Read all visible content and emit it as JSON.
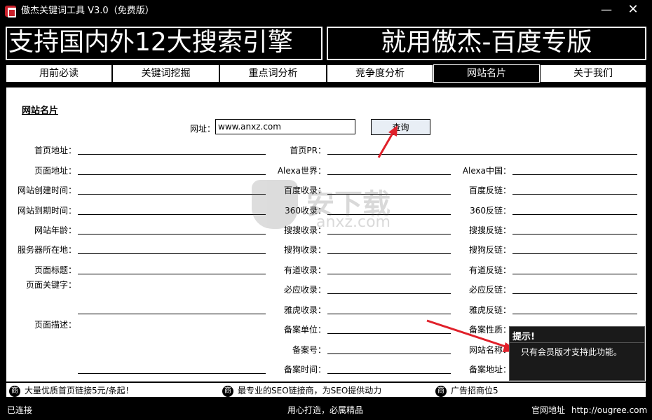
{
  "window": {
    "title": "傲杰关键词工具 V3.0（免费版）",
    "minimize": "—",
    "close": "✕"
  },
  "banner": {
    "left": "支持国内外12大搜索引擎",
    "right": "就用傲杰-百度专版"
  },
  "tabs": [
    {
      "label": "用前必读",
      "active": false
    },
    {
      "label": "关键词挖掘",
      "active": false
    },
    {
      "label": "重点词分析",
      "active": false
    },
    {
      "label": "竞争度分析",
      "active": false
    },
    {
      "label": "网站名片",
      "active": true
    },
    {
      "label": "关于我们",
      "active": false
    }
  ],
  "panel": {
    "section_title": "网站名片",
    "url_label": "网址：",
    "url_value": "www.anxz.com",
    "query_button": "查询"
  },
  "fields": {
    "col1": [
      {
        "label": "首页地址：",
        "value": ""
      },
      {
        "label": "页面地址：",
        "value": ""
      },
      {
        "label": "网站创建时间：",
        "value": ""
      },
      {
        "label": "网站到期时间：",
        "value": ""
      },
      {
        "label": "网站年龄：",
        "value": ""
      },
      {
        "label": "服务器所在地：",
        "value": ""
      },
      {
        "label": "页面标题：",
        "value": ""
      },
      {
        "label": "页面关键字：",
        "value": ""
      },
      {
        "label": "页面描述：",
        "value": ""
      }
    ],
    "homepage_pr": {
      "label": "首页PR：",
      "value": ""
    },
    "col2": [
      {
        "label": "Alexa世界：",
        "value": ""
      },
      {
        "label": "百度收录：",
        "value": ""
      },
      {
        "label": "360收录：",
        "value": ""
      },
      {
        "label": "搜搜收录：",
        "value": ""
      },
      {
        "label": "搜狗收录：",
        "value": ""
      },
      {
        "label": "有道收录：",
        "value": ""
      },
      {
        "label": "必应收录：",
        "value": ""
      },
      {
        "label": "雅虎收录：",
        "value": ""
      },
      {
        "label": "备案单位：",
        "value": ""
      },
      {
        "label": "备案号：",
        "value": ""
      },
      {
        "label": "备案时间：",
        "value": ""
      }
    ],
    "col3": [
      {
        "label": "Alexa中国：",
        "value": ""
      },
      {
        "label": "百度反链：",
        "value": ""
      },
      {
        "label": "360反链：",
        "value": ""
      },
      {
        "label": "搜搜反链：",
        "value": ""
      },
      {
        "label": "搜狗反链：",
        "value": ""
      },
      {
        "label": "有道反链：",
        "value": ""
      },
      {
        "label": "必应反链：",
        "value": ""
      },
      {
        "label": "雅虎反链：",
        "value": ""
      },
      {
        "label": "备案性质：",
        "value": ""
      },
      {
        "label": "网站名称：",
        "value": ""
      },
      {
        "label": "备案地址：",
        "value": ""
      }
    ]
  },
  "watermark": {
    "text": "安下载",
    "sub": "anxz.com"
  },
  "tooltip": {
    "title": "提示!",
    "message": "只有会员版才支持此功能。"
  },
  "ads": [
    {
      "icon": "商",
      "text": "大量优质首页链接5元/条起！"
    },
    {
      "icon": "商",
      "text": "最专业的SEO链接商，为SEO提供动力"
    },
    {
      "icon": "商",
      "text": "广告招商位5"
    }
  ],
  "status": {
    "left": "已连接",
    "center": "用心打造，必属精品",
    "right_label": "官网地址",
    "right_url": "http://ougree.com"
  },
  "colors": {
    "accent_arrow": "#e0202a",
    "icon_red": "#c8202a",
    "background": "#000000",
    "panel": "#ffffff"
  }
}
